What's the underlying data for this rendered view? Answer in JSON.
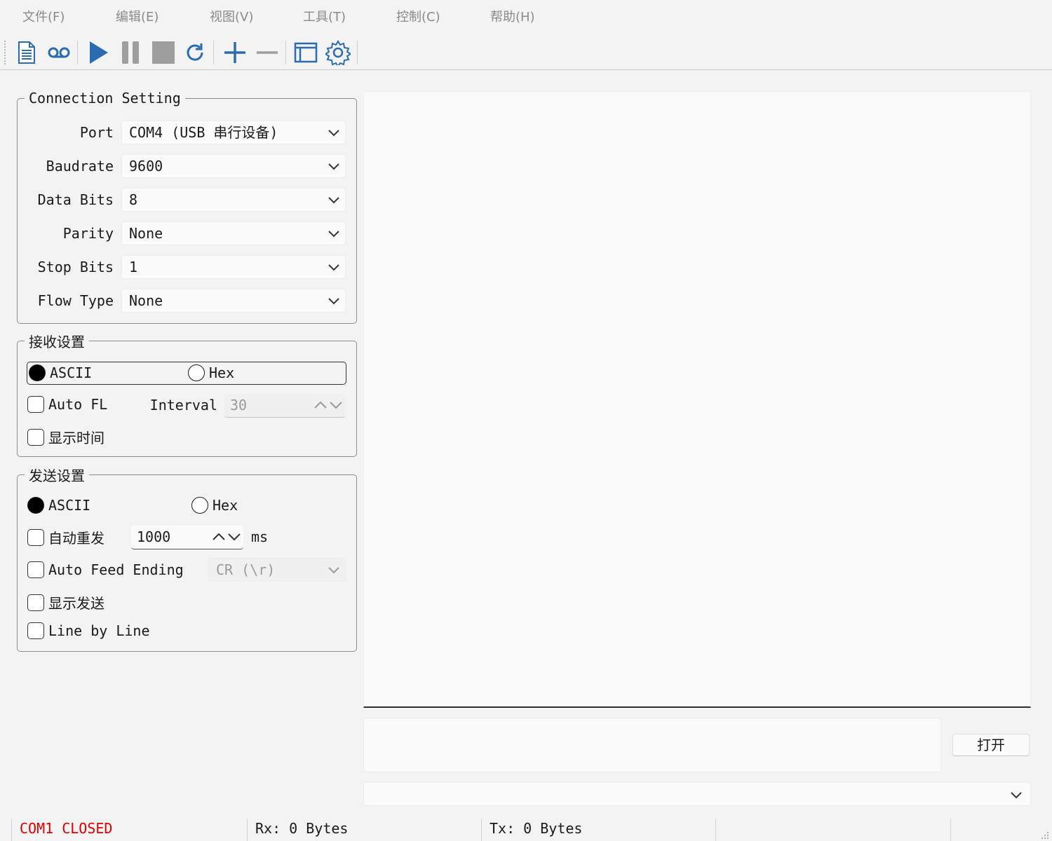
{
  "menu": [
    "文件(F)",
    "编辑(E)",
    "视图(V)",
    "工具(T)",
    "控制(C)",
    "帮助(H)"
  ],
  "toolbar": {
    "icons": [
      "document-icon",
      "record-icon",
      "play-icon",
      "pause-icon",
      "stop-icon",
      "refresh-icon",
      "add-icon",
      "remove-icon",
      "window-icon",
      "settings-icon"
    ],
    "accent": "#2b6cb0"
  },
  "connection": {
    "title": "Connection Setting",
    "fields": [
      {
        "label": "Port",
        "value": "COM4 (USB 串行设备)"
      },
      {
        "label": "Baudrate",
        "value": "9600"
      },
      {
        "label": "Data Bits",
        "value": "8"
      },
      {
        "label": "Parity",
        "value": "None"
      },
      {
        "label": "Stop Bits",
        "value": "1"
      },
      {
        "label": "Flow Type",
        "value": "None"
      }
    ]
  },
  "receive": {
    "title": "接收设置",
    "ascii_label": "ASCII",
    "hex_label": "Hex",
    "auto_fl_label": "Auto FL",
    "interval_label": "Interval",
    "interval_value": "30",
    "show_time_label": "显示时间"
  },
  "send": {
    "title": "发送设置",
    "ascii_label": "ASCII",
    "hex_label": "Hex",
    "auto_resend_label": "自动重发",
    "resend_value": "1000",
    "resend_unit": "ms",
    "auto_feed_label": "Auto Feed Ending",
    "feed_value": "CR (\\r)",
    "show_send_label": "显示发送",
    "line_by_line_label": "Line by Line"
  },
  "open_button": "打开",
  "status": {
    "port_state": "COM1 CLOSED",
    "port_state_color": "#e00000",
    "rx": "Rx: 0 Bytes",
    "tx": "Tx: 0 Bytes"
  }
}
